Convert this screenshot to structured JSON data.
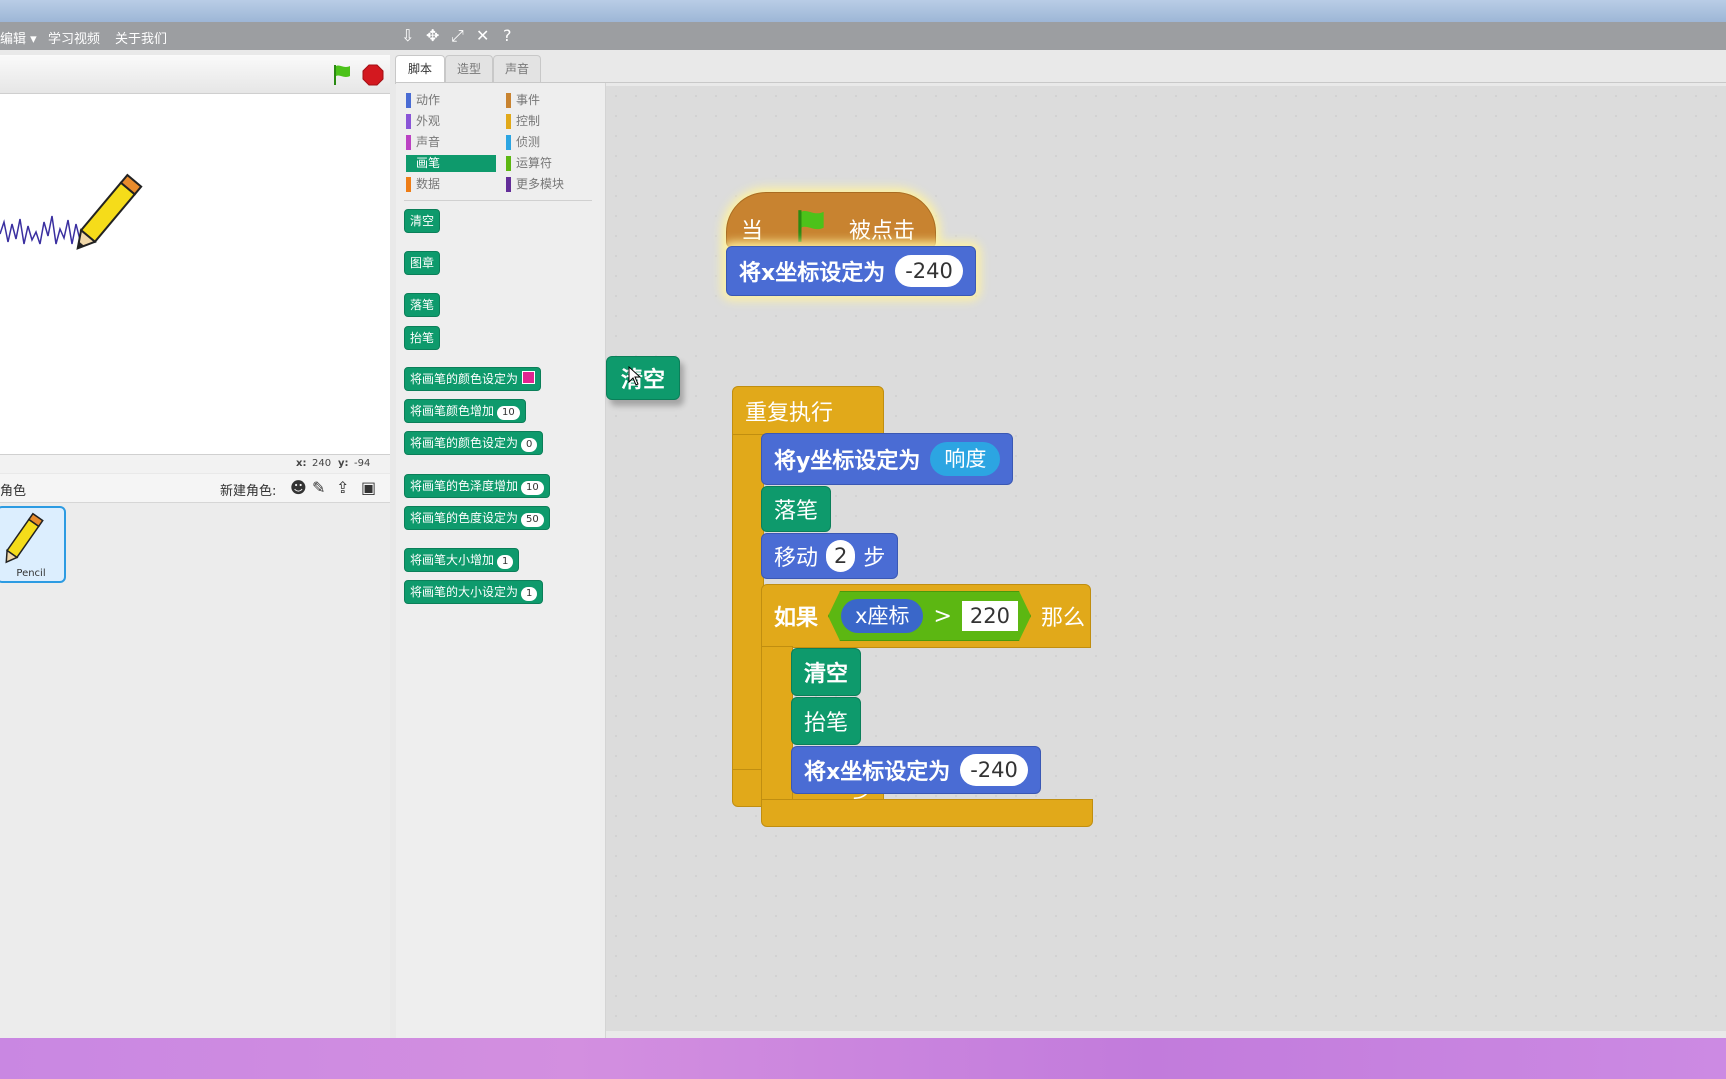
{
  "menu": {
    "items": [
      "编辑 ▾",
      "学习视频",
      "关于我们"
    ]
  },
  "stage": {
    "coords": {
      "x_label": "x:",
      "x_value": "240",
      "y_label": "y:",
      "y_value": "-94"
    }
  },
  "sprites": {
    "title": "角色",
    "new_sprite_label": "新建角色:",
    "items": [
      {
        "name": "Pencil"
      }
    ]
  },
  "tabs": [
    "脚本",
    "造型",
    "声音"
  ],
  "palette": {
    "categories_left": [
      {
        "label": "动作",
        "color": "#4a6cd4"
      },
      {
        "label": "外观",
        "color": "#8a55d7"
      },
      {
        "label": "声音",
        "color": "#bb42c3"
      },
      {
        "label": "画笔",
        "color": "#0e9a6c"
      },
      {
        "label": "数据",
        "color": "#ee7d16"
      }
    ],
    "categories_right": [
      {
        "label": "事件",
        "color": "#c88330"
      },
      {
        "label": "控制",
        "color": "#e1a91a"
      },
      {
        "label": "侦测",
        "color": "#2ca5e2"
      },
      {
        "label": "运算符",
        "color": "#5cb712"
      },
      {
        "label": "更多模块",
        "color": "#632d99"
      }
    ],
    "active_category": "画笔",
    "blocks": [
      {
        "label": "清空"
      },
      {
        "label": "图章"
      },
      {
        "label": "落笔"
      },
      {
        "label": "抬笔"
      },
      {
        "label": "将画笔的颜色设定为"
      },
      {
        "label": "将画笔颜色增加",
        "value": "10"
      },
      {
        "label": "将画笔的颜色设定为",
        "value": "0"
      },
      {
        "label": "将画笔的色泽度增加",
        "value": "10"
      },
      {
        "label": "将画笔的色度设定为",
        "value": "50"
      },
      {
        "label": "将画笔大小增加",
        "value": "1"
      },
      {
        "label": "将画笔的大小设定为",
        "value": "1"
      }
    ]
  },
  "script": {
    "hat": {
      "when": "当",
      "clicked": "被点击"
    },
    "set_x_1": {
      "label": "将x坐标设定为",
      "value": "-240"
    },
    "floating": {
      "label": "清空"
    },
    "repeat": {
      "label": "重复执行"
    },
    "set_y": {
      "label": "将y坐标设定为",
      "reporter": "响度"
    },
    "pen_down": {
      "label": "落笔"
    },
    "move": {
      "prefix": "移动",
      "value": "2",
      "suffix": "步"
    },
    "if": {
      "if_label": "如果",
      "reporter": "x座标",
      "op": ">",
      "value": "220",
      "then_label": "那么"
    },
    "clear": {
      "label": "清空"
    },
    "pen_up": {
      "label": "抬笔"
    },
    "set_x_2": {
      "label": "将x坐标设定为",
      "value": "-240"
    }
  },
  "colors": {
    "motion": "#4a6cd4",
    "pen": "#0e9a6c",
    "control": "#e1a91a",
    "event": "#c88330",
    "operators": "#5cb712",
    "sensing": "#2ca5e2"
  }
}
